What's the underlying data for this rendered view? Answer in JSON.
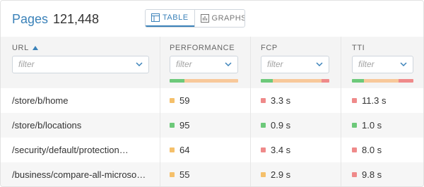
{
  "colors": {
    "accent": "#3b82b9",
    "good": "#6dc97a",
    "average": "#f5c06b",
    "poor": "#ef8a8a",
    "average_light": "#f8c89a"
  },
  "header": {
    "title": "Pages",
    "count": "121,448",
    "views": [
      {
        "label": "TABLE",
        "icon": "table-icon",
        "active": true
      },
      {
        "label": "GRAPHS",
        "icon": "bar-chart-icon",
        "active": false
      }
    ]
  },
  "columns": [
    {
      "key": "url",
      "label": "URL",
      "sorted": "ascending",
      "placeholder": "filter"
    },
    {
      "key": "performance",
      "label": "PERFORMANCE",
      "placeholder": "filter",
      "distribution": [
        {
          "status": "good",
          "fraction": 0.22
        },
        {
          "status": "average",
          "fraction": 0.78
        }
      ]
    },
    {
      "key": "fcp",
      "label": "FCP",
      "placeholder": "filter",
      "distribution": [
        {
          "status": "good",
          "fraction": 0.18
        },
        {
          "status": "average",
          "fraction": 0.71
        },
        {
          "status": "poor",
          "fraction": 0.11
        }
      ]
    },
    {
      "key": "tti",
      "label": "TTI",
      "placeholder": "filter",
      "distribution": [
        {
          "status": "good",
          "fraction": 0.2
        },
        {
          "status": "average",
          "fraction": 0.56
        },
        {
          "status": "poor",
          "fraction": 0.24
        }
      ]
    }
  ],
  "rows": [
    {
      "url": "/store/b/home",
      "performance": {
        "value": "59",
        "status": "average"
      },
      "fcp": {
        "value": "3.3 s",
        "status": "poor"
      },
      "tti": {
        "value": "11.3 s",
        "status": "poor"
      }
    },
    {
      "url": "/store/b/locations",
      "performance": {
        "value": "95",
        "status": "good"
      },
      "fcp": {
        "value": "0.9 s",
        "status": "good"
      },
      "tti": {
        "value": "1.0 s",
        "status": "good"
      }
    },
    {
      "url": "/security/default/protection…",
      "performance": {
        "value": "64",
        "status": "average"
      },
      "fcp": {
        "value": "3.4 s",
        "status": "poor"
      },
      "tti": {
        "value": "8.0 s",
        "status": "poor"
      }
    },
    {
      "url": "/business/compare-all-microso…",
      "performance": {
        "value": "55",
        "status": "average"
      },
      "fcp": {
        "value": "2.9 s",
        "status": "average"
      },
      "tti": {
        "value": "9.8 s",
        "status": "poor"
      }
    }
  ]
}
